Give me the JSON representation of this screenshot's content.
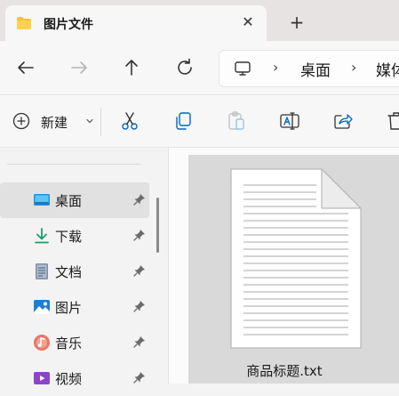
{
  "tab": {
    "title": "图片文件",
    "close": "✕",
    "new_tab": "+"
  },
  "address": {
    "crumbs": [
      "桌面",
      "媒体"
    ],
    "separator": "›"
  },
  "command_bar": {
    "new_label": "新建"
  },
  "sidebar": {
    "items": [
      {
        "label": "桌面",
        "icon": "desktop-icon",
        "active": true
      },
      {
        "label": "下载",
        "icon": "download-icon"
      },
      {
        "label": "文档",
        "icon": "document-icon"
      },
      {
        "label": "图片",
        "icon": "pictures-icon"
      },
      {
        "label": "音乐",
        "icon": "music-icon"
      },
      {
        "label": "视频",
        "icon": "videos-icon"
      }
    ]
  },
  "content": {
    "file_name": "商品标题.txt"
  },
  "colors": {
    "tab_strip": "#e8e3e3",
    "selection": "#d9d9d9",
    "accent": "#0067c0"
  }
}
